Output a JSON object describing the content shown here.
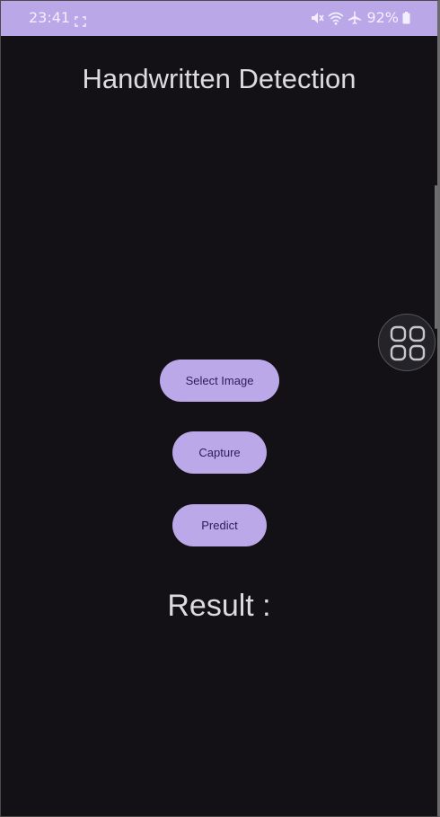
{
  "status_bar": {
    "time": "23:41",
    "battery_percent": "92%",
    "icons": [
      "screenshot-icon",
      "mute-icon",
      "wifi-icon",
      "airplane-icon",
      "battery-icon"
    ],
    "background_color": "#b9a7e8"
  },
  "app": {
    "title": "Handwritten Detection",
    "background_color": "#131115"
  },
  "buttons": {
    "select_image": "Select Image",
    "capture": "Capture",
    "predict": "Predict",
    "color": "#bba8e8",
    "text_color": "#2c1d5c"
  },
  "result": {
    "label": "Result :"
  },
  "overlay": {
    "floating_button_icon": "grid-apps-icon"
  }
}
